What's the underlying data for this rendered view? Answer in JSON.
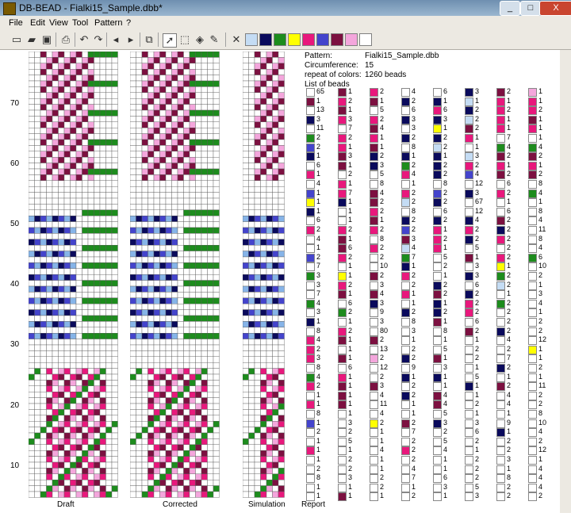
{
  "window": {
    "title": "DB-BEAD - Fialki15_Sample.dbb*",
    "minimize": "_",
    "maximize": "□",
    "close": "X"
  },
  "menu": [
    "File",
    "Edit",
    "View",
    "Tool",
    "Pattern",
    "?"
  ],
  "toolbar": {
    "icons": [
      "new-icon",
      "open-icon",
      "save-icon",
      "print-icon",
      "undo-icon",
      "redo-icon",
      "arrow-left-icon",
      "arrow-right-icon",
      "copy-icon",
      "pointer-icon",
      "select-rect-icon",
      "fill-icon",
      "eyedropper-icon",
      "clear-icon"
    ],
    "palette": [
      "#c4dcf4",
      "#0a0a5c",
      "#1d8c1d",
      "#ffff00",
      "#e8187c",
      "#4444cc",
      "#7c1040",
      "#f4a6dc",
      "#ffffff"
    ]
  },
  "ruler": {
    "labels": [
      "70",
      "60",
      "50",
      "40",
      "30",
      "20",
      "10"
    ]
  },
  "panels": {
    "draft": "Draft",
    "corrected": "Corrected",
    "simulation": "Simulation",
    "report": "Report"
  },
  "info": {
    "pattern_label": "Pattern:",
    "pattern_value": "Fialki15_Sample.dbb",
    "circ_label": "Circumference:",
    "circ_value": "15",
    "repeat_label": "repeat of colors:",
    "repeat_value": "1260 beads",
    "list_label": "List of beads"
  },
  "colors": {
    "W": "#ffffff",
    "L": "#c4dcf4",
    "N": "#0a0a5c",
    "G": "#1d8c1d",
    "Y": "#ffff00",
    "P": "#e8187c",
    "B": "#4444cc",
    "M": "#7c1040",
    "K": "#f4a6dc",
    "U": "#86b4e8"
  },
  "bead_list": [
    [
      "W65",
      "M1",
      "P2",
      "W4",
      "W6",
      "N3",
      "M2",
      "K1"
    ],
    [
      "M1",
      "P2",
      "M1",
      "N2",
      "N1",
      "L1",
      "P1",
      "P1"
    ],
    [
      "W13",
      "M1",
      "W5",
      "W6",
      "P6",
      "N2",
      "P2",
      "P2"
    ],
    [
      "N3",
      "P3",
      "P2",
      "N3",
      "N3",
      "L2",
      "P1",
      "M1"
    ],
    [
      "W11",
      "W7",
      "M4",
      "W3",
      "Y1",
      "M2",
      "P1",
      "P1"
    ],
    [
      "G2",
      "P2",
      "P1",
      "N2",
      "N2",
      "P1",
      "W7",
      "W1"
    ],
    [
      "B2",
      "P1",
      "M1",
      "W8",
      "L2",
      "W1",
      "G4",
      "G4"
    ],
    [
      "N1",
      "M3",
      "N2",
      "N1",
      "N1",
      "L3",
      "M2",
      "M2"
    ],
    [
      "W6",
      "M1",
      "N3",
      "G2",
      "N2",
      "P2",
      "P1",
      "P1"
    ],
    [
      "P1",
      "W2",
      "W5",
      "P4",
      "N2",
      "B4",
      "M2",
      "M2"
    ],
    [
      "W4",
      "P1",
      "W8",
      "W1",
      "W8",
      "W12",
      "W6",
      "W8"
    ],
    [
      "B1",
      "P7",
      "M4",
      "P2",
      "B2",
      "N3",
      "P2",
      "G4"
    ],
    [
      "Y1",
      "N1",
      "M2",
      "L2",
      "N2",
      "W67",
      "W1",
      "W1"
    ],
    [
      "N1",
      "W1",
      "P2",
      "W8",
      "W6",
      "W12",
      "W6",
      "W8"
    ],
    [
      "W6",
      "W1",
      "M1",
      "N2",
      "N2",
      "N4",
      "M2",
      "W4"
    ],
    [
      "P2",
      "P2",
      "P2",
      "B2",
      "P1",
      "P2",
      "N2",
      "W11"
    ],
    [
      "W4",
      "M1",
      "W8",
      "M3",
      "P2",
      "N2",
      "P2",
      "W8"
    ],
    [
      "W1",
      "M6",
      "P2",
      "L4",
      "P1",
      "W5",
      "W2",
      "W4"
    ],
    [
      "B2",
      "P2",
      "W2",
      "G7",
      "W5",
      "M1",
      "P2",
      "G6"
    ],
    [
      "W7",
      "W1",
      "W10",
      "N1",
      "W2",
      "W3",
      "Y1",
      "W10"
    ],
    [
      "G3",
      "Y1",
      "M2",
      "P2",
      "W1",
      "N3",
      "G2",
      "W2"
    ],
    [
      "W3",
      "P2",
      "W3",
      "W2",
      "N2",
      "W6",
      "L2",
      "W1"
    ],
    [
      "W7",
      "M1",
      "M4",
      "P1",
      "M2",
      "N2",
      "W1",
      "W3"
    ],
    [
      "G4",
      "W6",
      "N3",
      "W1",
      "N1",
      "P2",
      "G2",
      "W4"
    ],
    [
      "W3",
      "G2",
      "W9",
      "N2",
      "N2",
      "P2",
      "W2",
      "W1"
    ],
    [
      "N1",
      "W1",
      "W3",
      "W8",
      "M1",
      "W6",
      "W2",
      "W2"
    ],
    [
      "W8",
      "P2",
      "W80",
      "W3",
      "W8",
      "M2",
      "N2",
      "W2"
    ],
    [
      "P4",
      "M1",
      "M2",
      "W1",
      "W1",
      "W1",
      "W4",
      "W12"
    ],
    [
      "P2",
      "W1",
      "W13",
      "W2",
      "W5",
      "W2",
      "W2",
      "Y1"
    ],
    [
      "P3",
      "M1",
      "K2",
      "N2",
      "M1",
      "W2",
      "W7",
      "W1"
    ],
    [
      "W8",
      "W6",
      "W12",
      "W9",
      "W3",
      "W1",
      "N2",
      "W2"
    ],
    [
      "G4",
      "P1",
      "W2",
      "N1",
      "N1",
      "W5",
      "W1",
      "W1"
    ],
    [
      "P2",
      "M1",
      "M3",
      "W2",
      "W1",
      "N1",
      "M2",
      "W11"
    ],
    [
      "W1",
      "M1",
      "W4",
      "N2",
      "M4",
      "W1",
      "W4",
      "W2"
    ],
    [
      "P1",
      "M1",
      "W11",
      "W1",
      "M4",
      "W2",
      "W4",
      "W2"
    ],
    [
      "W8",
      "W1",
      "W4",
      "W1",
      "W5",
      "W1",
      "W1",
      "W8"
    ],
    [
      "B1",
      "W3",
      "Y2",
      "M2",
      "N3",
      "W3",
      "W9",
      "W10"
    ],
    [
      "W2",
      "W2",
      "W1",
      "W7",
      "W2",
      "W6",
      "N1",
      "W4"
    ],
    [
      "W1",
      "W5",
      "W1",
      "W2",
      "W5",
      "W2",
      "W2",
      "W2"
    ],
    [
      "P1",
      "W1",
      "W4",
      "P2",
      "W4",
      "W1",
      "W2",
      "W12"
    ],
    [
      "W1",
      "W2",
      "W1",
      "W2",
      "W1",
      "W2",
      "W3",
      "W1"
    ],
    [
      "W2",
      "W2",
      "W1",
      "W4",
      "W1",
      "W2",
      "W1",
      "W4"
    ],
    [
      "W8",
      "W3",
      "W2",
      "W7",
      "W6",
      "W2",
      "W8",
      "W4"
    ],
    [
      "W1",
      "W1",
      "W2",
      "W1",
      "W3",
      "W5",
      "W2",
      "W4"
    ],
    [
      "W1",
      "M1",
      "W1",
      "W2",
      "W1",
      "W3",
      "W2",
      "W2"
    ]
  ]
}
